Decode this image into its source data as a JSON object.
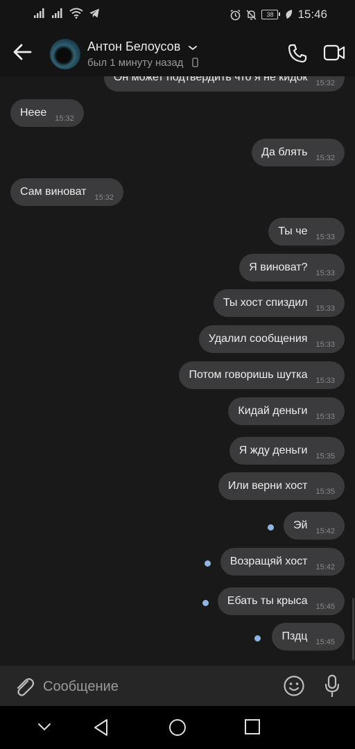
{
  "status_bar": {
    "time": "15:46",
    "battery": "38"
  },
  "header": {
    "contact_name": "Антон Белоусов",
    "last_seen": "был 1 минуту назад"
  },
  "messages": [
    {
      "dir": "out",
      "text": "Он может подтвердить что я не кидок",
      "time": "15:32",
      "partial": true
    },
    {
      "dir": "in",
      "text": "Неее",
      "time": "15:32"
    },
    {
      "dir": "out",
      "text": "Да блять",
      "time": "15:32"
    },
    {
      "dir": "in",
      "text": "Сам виноват",
      "time": "15:32"
    },
    {
      "dir": "out",
      "text": "Ты че",
      "time": "15:33"
    },
    {
      "dir": "out",
      "text": "Я виноват?",
      "time": "15:33"
    },
    {
      "dir": "out",
      "text": "Ты хост спиздил",
      "time": "15:33"
    },
    {
      "dir": "out",
      "text": "Удалил сообщения",
      "time": "15:33"
    },
    {
      "dir": "out",
      "text": "Потом говоришь шутка",
      "time": "15:33"
    },
    {
      "dir": "out",
      "text": "Кидай деньги",
      "time": "15:33"
    },
    {
      "dir": "out",
      "text": "Я жду деньги",
      "time": "15:35"
    },
    {
      "dir": "out",
      "text": "Или верни хост",
      "time": "15:35"
    },
    {
      "dir": "out",
      "text": "Эй",
      "time": "15:42",
      "unread": true
    },
    {
      "dir": "out",
      "text": "Возращяй хост",
      "time": "15:42",
      "unread": true
    },
    {
      "dir": "out",
      "text": "Ебать ты крыса",
      "time": "15:45",
      "unread": true
    },
    {
      "dir": "out",
      "text": "Пздц",
      "time": "15:45",
      "unread": true
    }
  ],
  "composer": {
    "placeholder": "Сообщение"
  },
  "colors": {
    "background": "#19191a",
    "bubble": "#3b3b3d",
    "unread_dot": "#8fb5e3",
    "bar": "#141414"
  },
  "icons": [
    "signal-icon",
    "wifi-icon",
    "telegram-icon",
    "alarm-icon",
    "mute-icon",
    "battery-icon",
    "leaf-icon",
    "back-arrow-icon",
    "chevron-down-icon",
    "phone-icon",
    "video-icon",
    "attach-icon",
    "emoji-icon",
    "mic-icon",
    "nav-back-icon",
    "nav-home-icon",
    "nav-recents-icon"
  ]
}
